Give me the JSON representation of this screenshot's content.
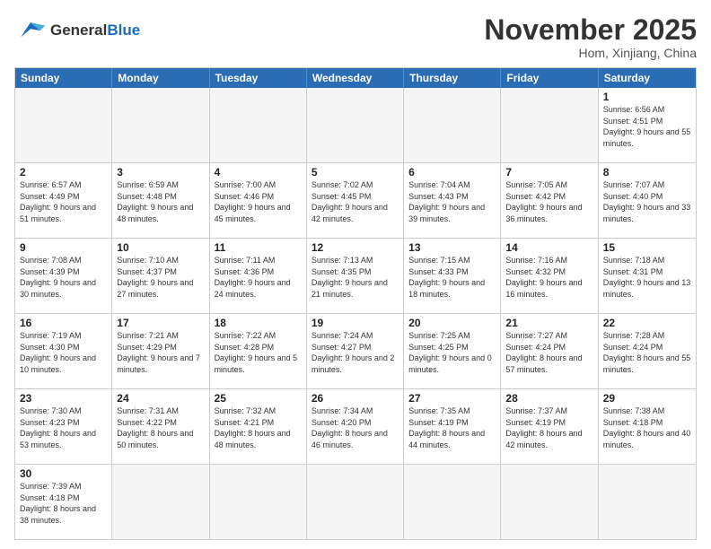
{
  "header": {
    "logo_general": "General",
    "logo_blue": "Blue",
    "month_title": "November 2025",
    "location": "Hom, Xinjiang, China"
  },
  "days_of_week": [
    "Sunday",
    "Monday",
    "Tuesday",
    "Wednesday",
    "Thursday",
    "Friday",
    "Saturday"
  ],
  "weeks": [
    [
      {
        "day": "",
        "info": ""
      },
      {
        "day": "",
        "info": ""
      },
      {
        "day": "",
        "info": ""
      },
      {
        "day": "",
        "info": ""
      },
      {
        "day": "",
        "info": ""
      },
      {
        "day": "",
        "info": ""
      },
      {
        "day": "1",
        "info": "Sunrise: 6:56 AM\nSunset: 4:51 PM\nDaylight: 9 hours and 55 minutes."
      }
    ],
    [
      {
        "day": "2",
        "info": "Sunrise: 6:57 AM\nSunset: 4:49 PM\nDaylight: 9 hours and 51 minutes."
      },
      {
        "day": "3",
        "info": "Sunrise: 6:59 AM\nSunset: 4:48 PM\nDaylight: 9 hours and 48 minutes."
      },
      {
        "day": "4",
        "info": "Sunrise: 7:00 AM\nSunset: 4:46 PM\nDaylight: 9 hours and 45 minutes."
      },
      {
        "day": "5",
        "info": "Sunrise: 7:02 AM\nSunset: 4:45 PM\nDaylight: 9 hours and 42 minutes."
      },
      {
        "day": "6",
        "info": "Sunrise: 7:04 AM\nSunset: 4:43 PM\nDaylight: 9 hours and 39 minutes."
      },
      {
        "day": "7",
        "info": "Sunrise: 7:05 AM\nSunset: 4:42 PM\nDaylight: 9 hours and 36 minutes."
      },
      {
        "day": "8",
        "info": "Sunrise: 7:07 AM\nSunset: 4:40 PM\nDaylight: 9 hours and 33 minutes."
      }
    ],
    [
      {
        "day": "9",
        "info": "Sunrise: 7:08 AM\nSunset: 4:39 PM\nDaylight: 9 hours and 30 minutes."
      },
      {
        "day": "10",
        "info": "Sunrise: 7:10 AM\nSunset: 4:37 PM\nDaylight: 9 hours and 27 minutes."
      },
      {
        "day": "11",
        "info": "Sunrise: 7:11 AM\nSunset: 4:36 PM\nDaylight: 9 hours and 24 minutes."
      },
      {
        "day": "12",
        "info": "Sunrise: 7:13 AM\nSunset: 4:35 PM\nDaylight: 9 hours and 21 minutes."
      },
      {
        "day": "13",
        "info": "Sunrise: 7:15 AM\nSunset: 4:33 PM\nDaylight: 9 hours and 18 minutes."
      },
      {
        "day": "14",
        "info": "Sunrise: 7:16 AM\nSunset: 4:32 PM\nDaylight: 9 hours and 16 minutes."
      },
      {
        "day": "15",
        "info": "Sunrise: 7:18 AM\nSunset: 4:31 PM\nDaylight: 9 hours and 13 minutes."
      }
    ],
    [
      {
        "day": "16",
        "info": "Sunrise: 7:19 AM\nSunset: 4:30 PM\nDaylight: 9 hours and 10 minutes."
      },
      {
        "day": "17",
        "info": "Sunrise: 7:21 AM\nSunset: 4:29 PM\nDaylight: 9 hours and 7 minutes."
      },
      {
        "day": "18",
        "info": "Sunrise: 7:22 AM\nSunset: 4:28 PM\nDaylight: 9 hours and 5 minutes."
      },
      {
        "day": "19",
        "info": "Sunrise: 7:24 AM\nSunset: 4:27 PM\nDaylight: 9 hours and 2 minutes."
      },
      {
        "day": "20",
        "info": "Sunrise: 7:25 AM\nSunset: 4:25 PM\nDaylight: 9 hours and 0 minutes."
      },
      {
        "day": "21",
        "info": "Sunrise: 7:27 AM\nSunset: 4:24 PM\nDaylight: 8 hours and 57 minutes."
      },
      {
        "day": "22",
        "info": "Sunrise: 7:28 AM\nSunset: 4:24 PM\nDaylight: 8 hours and 55 minutes."
      }
    ],
    [
      {
        "day": "23",
        "info": "Sunrise: 7:30 AM\nSunset: 4:23 PM\nDaylight: 8 hours and 53 minutes."
      },
      {
        "day": "24",
        "info": "Sunrise: 7:31 AM\nSunset: 4:22 PM\nDaylight: 8 hours and 50 minutes."
      },
      {
        "day": "25",
        "info": "Sunrise: 7:32 AM\nSunset: 4:21 PM\nDaylight: 8 hours and 48 minutes."
      },
      {
        "day": "26",
        "info": "Sunrise: 7:34 AM\nSunset: 4:20 PM\nDaylight: 8 hours and 46 minutes."
      },
      {
        "day": "27",
        "info": "Sunrise: 7:35 AM\nSunset: 4:19 PM\nDaylight: 8 hours and 44 minutes."
      },
      {
        "day": "28",
        "info": "Sunrise: 7:37 AM\nSunset: 4:19 PM\nDaylight: 8 hours and 42 minutes."
      },
      {
        "day": "29",
        "info": "Sunrise: 7:38 AM\nSunset: 4:18 PM\nDaylight: 8 hours and 40 minutes."
      }
    ],
    [
      {
        "day": "30",
        "info": "Sunrise: 7:39 AM\nSunset: 4:18 PM\nDaylight: 8 hours and 38 minutes."
      },
      {
        "day": "",
        "info": ""
      },
      {
        "day": "",
        "info": ""
      },
      {
        "day": "",
        "info": ""
      },
      {
        "day": "",
        "info": ""
      },
      {
        "day": "",
        "info": ""
      },
      {
        "day": "",
        "info": ""
      }
    ]
  ]
}
